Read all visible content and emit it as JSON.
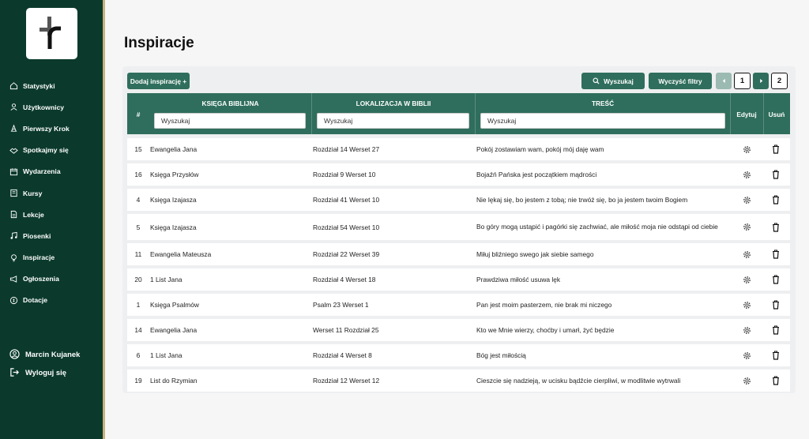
{
  "app": {
    "logo_icon": "cross-logo-icon"
  },
  "sidebar": {
    "items": [
      {
        "label": "Statystyki",
        "icon": "home-icon"
      },
      {
        "label": "Użytkownicy",
        "icon": "user-icon"
      },
      {
        "label": "Pierwszy Krok",
        "icon": "steps-icon"
      },
      {
        "label": "Spotkajmy się",
        "icon": "handshake-icon"
      },
      {
        "label": "Wydarzenia",
        "icon": "calendar-icon"
      },
      {
        "label": "Kursy",
        "icon": "book-icon"
      },
      {
        "label": "Lekcje",
        "icon": "document-icon"
      },
      {
        "label": "Piosenki",
        "icon": "music-icon"
      },
      {
        "label": "Inspiracje",
        "icon": "lightbulb-icon"
      },
      {
        "label": "Ogłoszenia",
        "icon": "megaphone-icon"
      },
      {
        "label": "Dotacje",
        "icon": "coin-icon"
      }
    ],
    "user_name": "Marcin Kujanek",
    "logout_label": "Wyloguj się"
  },
  "page": {
    "title": "Inspiracje"
  },
  "toolbar": {
    "add_label": "Dodaj inspirację +",
    "search_label": "Wyszukaj",
    "clear_label": "Wyczyść filtry",
    "pages": [
      "1",
      "2"
    ]
  },
  "table": {
    "headers": {
      "id": "#",
      "book": "KSIĘGA BIBLIJNA",
      "location": "LOKALIZACJA W BIBLII",
      "text": "TREŚĆ",
      "edit": "Edytuj",
      "delete": "Usuń"
    },
    "filter_placeholder": "Wyszukaj",
    "rows": [
      {
        "id": "15",
        "book": "Ewangelia Jana",
        "location": "Rozdział 14 Werset 27",
        "text": "Pokój zostawiam wam, pokój mój daję wam"
      },
      {
        "id": "16",
        "book": "Księga Przysłów",
        "location": "Rozdział 9 Werset 10",
        "text": "Bojaźń Pańska jest początkiem mądrości"
      },
      {
        "id": "4",
        "book": "Księga Izajasza",
        "location": "Rozdział 41 Werset 10",
        "text": "Nie lękaj się, bo jestem z tobą; nie trwóż się, bo ja jestem twoim Bogiem"
      },
      {
        "id": "5",
        "book": "Księga Izajasza",
        "location": "Rozdział 54 Werset 10",
        "text": "Bo góry mogą ustąpić i pagórki się zachwiać, ale miłość moja nie odstąpi od ciebie"
      },
      {
        "id": "11",
        "book": "Ewangelia Mateusza",
        "location": "Rozdział 22 Werset 39",
        "text": "Miłuj bliźniego swego jak siebie samego"
      },
      {
        "id": "20",
        "book": "1 List Jana",
        "location": "Rozdział 4 Werset 18",
        "text": "Prawdziwa miłość usuwa lęk"
      },
      {
        "id": "1",
        "book": "Księga Psalmów",
        "location": "Psalm 23 Werset 1",
        "text": "Pan jest moim pasterzem, nie brak mi niczego"
      },
      {
        "id": "14",
        "book": "Ewangelia Jana",
        "location": "Werset 11 Rozdział 25",
        "text": "Kto we Mnie wierzy, choćby i umarł, żyć będzie"
      },
      {
        "id": "6",
        "book": "1 List Jana",
        "location": "Rozdział 4 Werset 8",
        "text": "Bóg jest miłością"
      },
      {
        "id": "19",
        "book": "List do Rzymian",
        "location": "Rozdział 12 Werset 12",
        "text": "Cieszcie się nadzieją, w ucisku bądźcie cierpliwi, w modlitwie wytrwali"
      }
    ]
  },
  "colors": {
    "sidebar_bg": "#0b3a2c",
    "accent": "#2f6e5c",
    "gold": "#c8b27a",
    "panel_bg": "#eeeff0"
  }
}
